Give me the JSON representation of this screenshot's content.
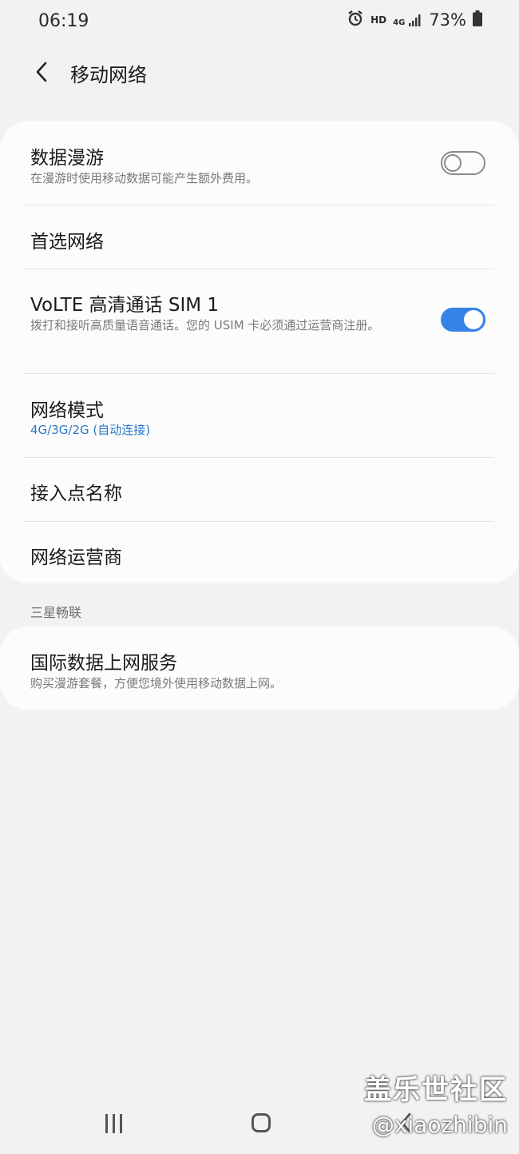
{
  "status_bar": {
    "time": "06:19",
    "hd_label": "HD",
    "network_label": "4G",
    "battery": "73%"
  },
  "header": {
    "title": "移动网络"
  },
  "settings": [
    {
      "title": "数据漫游",
      "subtitle": "在漫游时使用移动数据可能产生额外费用。",
      "toggle": "off"
    },
    {
      "title": "首选网络"
    },
    {
      "title": "VoLTE 高清通话 SIM 1",
      "subtitle": "拨打和接听高质量语音通话。您的 USIM 卡必须通过运营商注册。",
      "toggle": "on"
    },
    {
      "title": "网络模式",
      "subtitle": "4G/3G/2G (自动连接)"
    },
    {
      "title": "接入点名称"
    },
    {
      "title": "网络运营商"
    }
  ],
  "section": {
    "header": "三星畅联",
    "items": [
      {
        "title": "国际数据上网服务",
        "subtitle": "购买漫游套餐，方便您境外使用移动数据上网。"
      }
    ]
  },
  "watermark": {
    "line1": "盖乐世社区",
    "line2": "@xiaozhibin"
  },
  "colors": {
    "accent": "#3683e8",
    "link_blue": "#2a77c9",
    "background": "#f2f2f2",
    "card": "#fcfcfc"
  }
}
